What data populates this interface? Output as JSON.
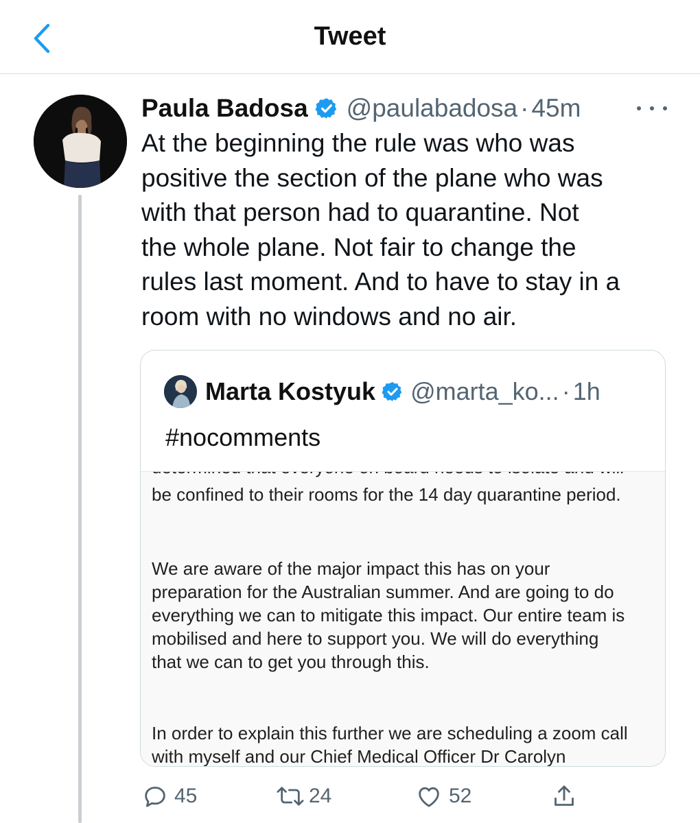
{
  "header": {
    "title": "Tweet",
    "back_icon": "chevron-left-icon"
  },
  "tweet": {
    "author_name": "Paula Badosa",
    "handle": "@paulabadosa",
    "separator": "·",
    "time": "45m",
    "lines": [
      "At the beginning the rule was who was",
      "positive the section of the plane who was",
      "with that person had to quarantine. Not",
      "the whole plane. Not fair to change the",
      "rules last moment. And to have to stay in a",
      "room with no windows and no air."
    ]
  },
  "quote": {
    "author_name": "Marta Kostyuk",
    "handle": "@marta_ko...",
    "separator": "·",
    "time": "1h",
    "text": "#nocomments",
    "image": {
      "cut_line": "determined that everyone on board needs to isolate and will",
      "p1": "be confined to their rooms for the 14 day quarantine period.",
      "p2_lines": [
        "We are aware of the major impact this has on your",
        "preparation for the Australian summer. And are going to do",
        "everything we can to mitigate this impact. Our entire team is",
        "mobilised and here to support you. We will do everything",
        "that we can to get you through this."
      ],
      "p3_lines": [
        "In order to explain this further we are scheduling a zoom call",
        "with myself and our Chief Medical Officer Dr Carolyn"
      ]
    }
  },
  "actions": {
    "replies": "45",
    "retweets": "24",
    "likes": "52"
  },
  "colors": {
    "accent": "#1d9bf0",
    "text_secondary": "#536471",
    "border": "#cfd9de"
  }
}
